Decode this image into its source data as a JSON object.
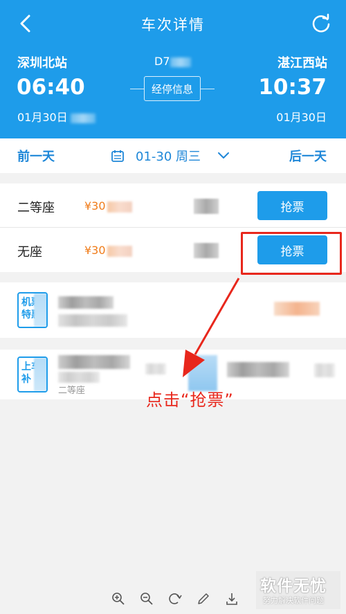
{
  "header": {
    "title": "车次详情",
    "departure": {
      "station": "深圳北站",
      "time": "06:40",
      "date": "01月30日"
    },
    "arrival": {
      "station": "湛江西站",
      "time": "10:37",
      "date": "01月30日"
    },
    "train_no_prefix": "D7",
    "stops_button": "经停信息",
    "colors": {
      "header_bg": "#1e9cea"
    }
  },
  "date_bar": {
    "prev_label": "前一天",
    "current_date": "01-30 周三",
    "next_label": "后一天"
  },
  "seats": [
    {
      "name": "二等座",
      "price_prefix": "¥30",
      "button": "抢票"
    },
    {
      "name": "无座",
      "price_prefix": "¥30",
      "button": "抢票"
    }
  ],
  "promo_cards": [
    {
      "badge": "机票特惠"
    },
    {
      "badge": "上车补",
      "small_text": "二等座"
    }
  ],
  "annotation": {
    "text": "点击“抢票”",
    "color": "#e8271c"
  },
  "toolbar": {
    "icons": [
      "zoom-in-icon",
      "zoom-out-icon",
      "rotate-icon",
      "pen-icon",
      "download-icon"
    ]
  },
  "watermark": {
    "title": "软件无忧",
    "subtitle": "努力解决软件问题"
  }
}
